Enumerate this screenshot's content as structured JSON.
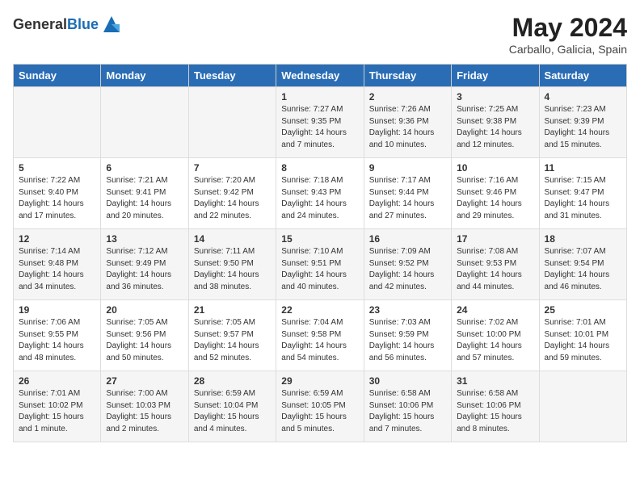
{
  "header": {
    "logo_general": "General",
    "logo_blue": "Blue",
    "month_year": "May 2024",
    "location": "Carballo, Galicia, Spain"
  },
  "days_of_week": [
    "Sunday",
    "Monday",
    "Tuesday",
    "Wednesday",
    "Thursday",
    "Friday",
    "Saturday"
  ],
  "weeks": [
    [
      {
        "day": "",
        "content": ""
      },
      {
        "day": "",
        "content": ""
      },
      {
        "day": "",
        "content": ""
      },
      {
        "day": "1",
        "content": "Sunrise: 7:27 AM\nSunset: 9:35 PM\nDaylight: 14 hours\nand 7 minutes."
      },
      {
        "day": "2",
        "content": "Sunrise: 7:26 AM\nSunset: 9:36 PM\nDaylight: 14 hours\nand 10 minutes."
      },
      {
        "day": "3",
        "content": "Sunrise: 7:25 AM\nSunset: 9:38 PM\nDaylight: 14 hours\nand 12 minutes."
      },
      {
        "day": "4",
        "content": "Sunrise: 7:23 AM\nSunset: 9:39 PM\nDaylight: 14 hours\nand 15 minutes."
      }
    ],
    [
      {
        "day": "5",
        "content": "Sunrise: 7:22 AM\nSunset: 9:40 PM\nDaylight: 14 hours\nand 17 minutes."
      },
      {
        "day": "6",
        "content": "Sunrise: 7:21 AM\nSunset: 9:41 PM\nDaylight: 14 hours\nand 20 minutes."
      },
      {
        "day": "7",
        "content": "Sunrise: 7:20 AM\nSunset: 9:42 PM\nDaylight: 14 hours\nand 22 minutes."
      },
      {
        "day": "8",
        "content": "Sunrise: 7:18 AM\nSunset: 9:43 PM\nDaylight: 14 hours\nand 24 minutes."
      },
      {
        "day": "9",
        "content": "Sunrise: 7:17 AM\nSunset: 9:44 PM\nDaylight: 14 hours\nand 27 minutes."
      },
      {
        "day": "10",
        "content": "Sunrise: 7:16 AM\nSunset: 9:46 PM\nDaylight: 14 hours\nand 29 minutes."
      },
      {
        "day": "11",
        "content": "Sunrise: 7:15 AM\nSunset: 9:47 PM\nDaylight: 14 hours\nand 31 minutes."
      }
    ],
    [
      {
        "day": "12",
        "content": "Sunrise: 7:14 AM\nSunset: 9:48 PM\nDaylight: 14 hours\nand 34 minutes."
      },
      {
        "day": "13",
        "content": "Sunrise: 7:12 AM\nSunset: 9:49 PM\nDaylight: 14 hours\nand 36 minutes."
      },
      {
        "day": "14",
        "content": "Sunrise: 7:11 AM\nSunset: 9:50 PM\nDaylight: 14 hours\nand 38 minutes."
      },
      {
        "day": "15",
        "content": "Sunrise: 7:10 AM\nSunset: 9:51 PM\nDaylight: 14 hours\nand 40 minutes."
      },
      {
        "day": "16",
        "content": "Sunrise: 7:09 AM\nSunset: 9:52 PM\nDaylight: 14 hours\nand 42 minutes."
      },
      {
        "day": "17",
        "content": "Sunrise: 7:08 AM\nSunset: 9:53 PM\nDaylight: 14 hours\nand 44 minutes."
      },
      {
        "day": "18",
        "content": "Sunrise: 7:07 AM\nSunset: 9:54 PM\nDaylight: 14 hours\nand 46 minutes."
      }
    ],
    [
      {
        "day": "19",
        "content": "Sunrise: 7:06 AM\nSunset: 9:55 PM\nDaylight: 14 hours\nand 48 minutes."
      },
      {
        "day": "20",
        "content": "Sunrise: 7:05 AM\nSunset: 9:56 PM\nDaylight: 14 hours\nand 50 minutes."
      },
      {
        "day": "21",
        "content": "Sunrise: 7:05 AM\nSunset: 9:57 PM\nDaylight: 14 hours\nand 52 minutes."
      },
      {
        "day": "22",
        "content": "Sunrise: 7:04 AM\nSunset: 9:58 PM\nDaylight: 14 hours\nand 54 minutes."
      },
      {
        "day": "23",
        "content": "Sunrise: 7:03 AM\nSunset: 9:59 PM\nDaylight: 14 hours\nand 56 minutes."
      },
      {
        "day": "24",
        "content": "Sunrise: 7:02 AM\nSunset: 10:00 PM\nDaylight: 14 hours\nand 57 minutes."
      },
      {
        "day": "25",
        "content": "Sunrise: 7:01 AM\nSunset: 10:01 PM\nDaylight: 14 hours\nand 59 minutes."
      }
    ],
    [
      {
        "day": "26",
        "content": "Sunrise: 7:01 AM\nSunset: 10:02 PM\nDaylight: 15 hours\nand 1 minute."
      },
      {
        "day": "27",
        "content": "Sunrise: 7:00 AM\nSunset: 10:03 PM\nDaylight: 15 hours\nand 2 minutes."
      },
      {
        "day": "28",
        "content": "Sunrise: 6:59 AM\nSunset: 10:04 PM\nDaylight: 15 hours\nand 4 minutes."
      },
      {
        "day": "29",
        "content": "Sunrise: 6:59 AM\nSunset: 10:05 PM\nDaylight: 15 hours\nand 5 minutes."
      },
      {
        "day": "30",
        "content": "Sunrise: 6:58 AM\nSunset: 10:06 PM\nDaylight: 15 hours\nand 7 minutes."
      },
      {
        "day": "31",
        "content": "Sunrise: 6:58 AM\nSunset: 10:06 PM\nDaylight: 15 hours\nand 8 minutes."
      },
      {
        "day": "",
        "content": ""
      }
    ]
  ]
}
